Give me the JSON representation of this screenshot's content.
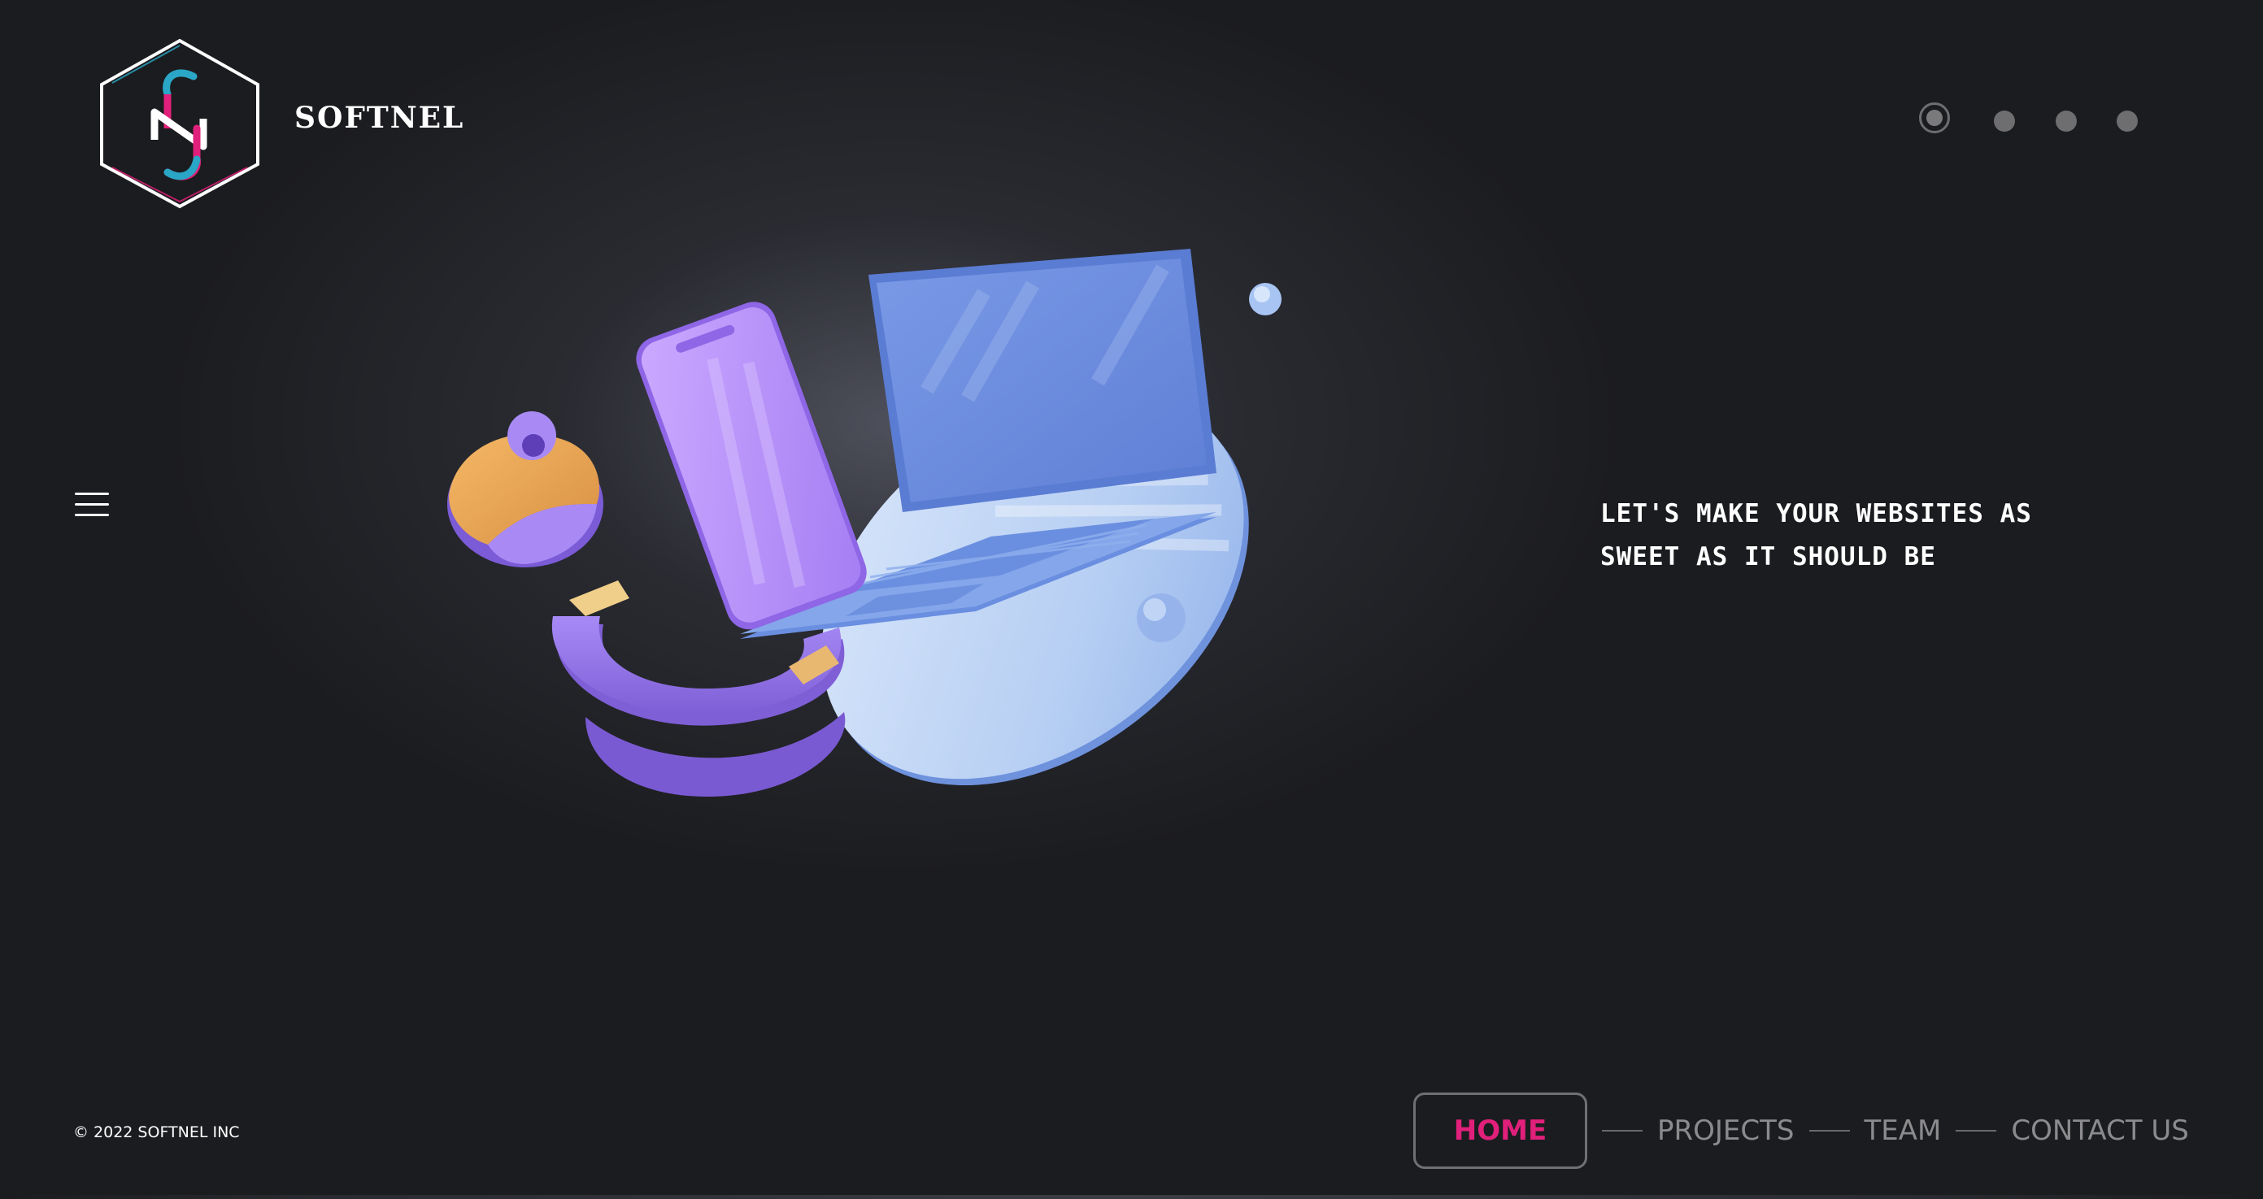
{
  "brand": {
    "name": "SOFTNEL",
    "logo_icon": "hexagon-sn-logo",
    "colors": {
      "pink": "#e0207a",
      "teal": "#2aa6c6",
      "white": "#ffffff"
    }
  },
  "pager": {
    "dots": [
      {
        "label": "slide-1",
        "active": true
      },
      {
        "label": "slide-2",
        "active": false
      },
      {
        "label": "slide-3",
        "active": false
      },
      {
        "label": "slide-4",
        "active": false
      }
    ]
  },
  "menu": {
    "icon": "hamburger-menu-icon"
  },
  "hero": {
    "tagline_line1": "LET'S MAKE YOUR WEBSITES AS",
    "tagline_line2": "SWEET AS IT SHOULD BE",
    "illustration": "3d-devices-illustration"
  },
  "footer": {
    "copyright": "© 2022 SOFTNEL INC",
    "nav": {
      "home": "HOME",
      "projects": "PROJECTS",
      "team": "TEAM",
      "contact": "CONTACT US"
    },
    "active_color": "#e0207a",
    "inactive_color": "#8b8b8d"
  },
  "theme": {
    "background": "#1b1c1f",
    "accent": "#e0207a",
    "device_purple": "#a98af5",
    "device_blue": "#7b9fe6"
  }
}
